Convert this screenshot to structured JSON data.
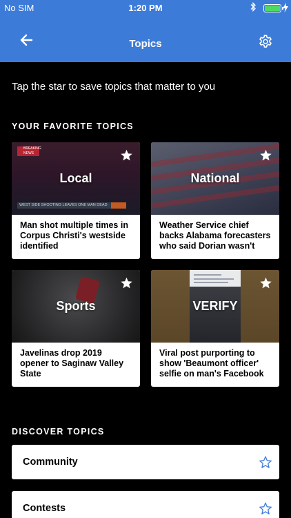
{
  "status_bar": {
    "carrier": "No SIM",
    "time": "1:20 PM",
    "battery_level": 1.0,
    "battery_color": "#4cd964"
  },
  "nav": {
    "title": "Topics",
    "back_icon": "arrow-left-icon",
    "settings_icon": "gear-icon",
    "background": "#3d7bd9"
  },
  "intro_text": "Tap the star to save topics that matter to you",
  "favorites": {
    "heading": "YOUR FAVORITE TOPICS",
    "cards": [
      {
        "topic": "Local",
        "headline": "Man shot multiple times in Corpus Christi's westside identified",
        "banner": "WEST SIDE SHOOTING LEAVES ONE MAN DEAD",
        "logo": "BREAKING NEWS",
        "starred": true
      },
      {
        "topic": "National",
        "headline": "Weather Service chief backs Alabama forecasters who said Dorian wasn't threat",
        "starred": true
      },
      {
        "topic": "Sports",
        "headline": "Javelinas drop 2019 opener to Saginaw Valley State",
        "starred": true
      },
      {
        "topic": "VERIFY",
        "headline": "Viral post purporting to show 'Beaumont officer' selfie on man's Facebook p...",
        "starred": true
      }
    ]
  },
  "discover": {
    "heading": "DISCOVER TOPICS",
    "items": [
      {
        "label": "Community",
        "starred": false
      },
      {
        "label": "Contests",
        "starred": false
      }
    ]
  },
  "colors": {
    "accent": "#3d7bd9",
    "star_outline": "#3d7bd9"
  }
}
